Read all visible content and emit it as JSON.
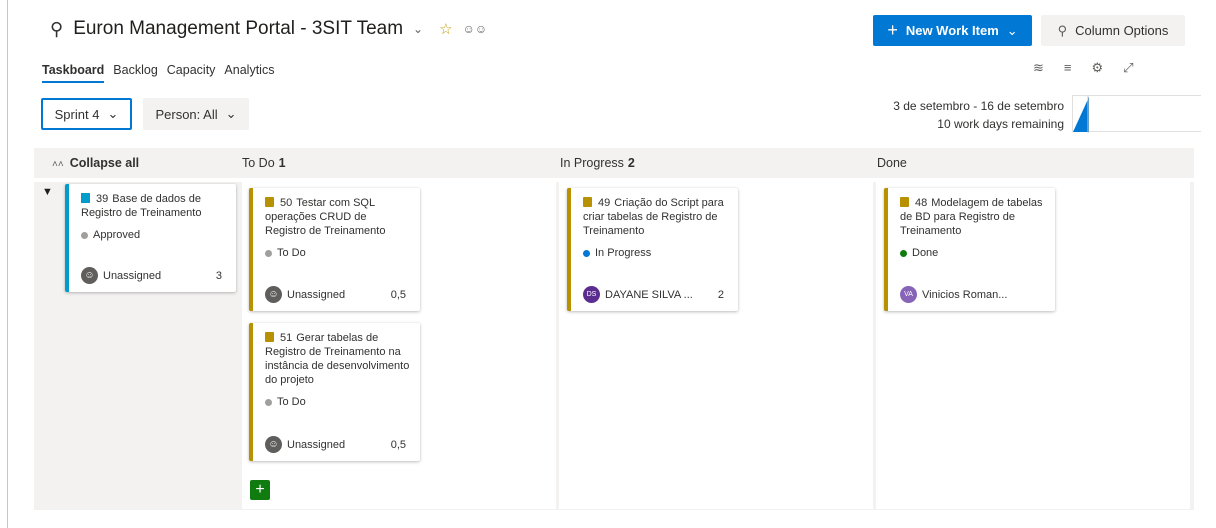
{
  "header": {
    "title": "Euron Management Portal - 3SIT Team",
    "team_icon": "team-icon",
    "favorite_icon": "star-icon",
    "members_icon": "people-icon"
  },
  "toolbar": {
    "new_work_item": "New Work Item",
    "column_options": "Column Options"
  },
  "tabs": [
    "Taskboard",
    "Backlog",
    "Capacity",
    "Analytics"
  ],
  "filters": {
    "sprint": "Sprint 4",
    "person": "Person: All"
  },
  "sprint_info": {
    "dates": "3 de setembro - 16 de setembro",
    "remaining": "10 work days remaining"
  },
  "columns": {
    "collapse_all": "Collapse all",
    "todo": {
      "label": "To Do",
      "count": "1"
    },
    "in_progress": {
      "label": "In Progress",
      "count": "2"
    },
    "done": {
      "label": "Done",
      "count": ""
    }
  },
  "backlog_item": {
    "id": "39",
    "title": "Base de dados de Registro de Treinamento",
    "state": "Approved",
    "assignee": "Unassigned",
    "effort": "3"
  },
  "tasks": {
    "t50": {
      "id": "50",
      "title": "Testar com SQL operações CRUD de Registro de Treinamento",
      "state": "To Do",
      "assignee": "Unassigned",
      "remaining": "0,5"
    },
    "t51": {
      "id": "51",
      "title": "Gerar tabelas de Registro de Treinamento na instância de desenvolvimento do projeto",
      "state": "To Do",
      "assignee": "Unassigned",
      "remaining": "0,5"
    },
    "t49": {
      "id": "49",
      "title": "Criação do Script para criar tabelas de Registro de Treinamento",
      "state": "In Progress",
      "assignee": "DAYANE SILVA ...",
      "initials": "DS",
      "remaining": "2"
    },
    "t48": {
      "id": "48",
      "title": "Modelagem de tabelas de BD para Registro de Treinamento",
      "state": "Done",
      "assignee": "Vinicios Roman...",
      "initials": "VA"
    }
  },
  "colors": {
    "accent": "#0078d4",
    "task": "#b79100",
    "pbi": "#009ccc",
    "state_todo": "#a19f9d",
    "state_inprogress": "#0078d4",
    "state_done": "#107c10",
    "state_approved": "#a19f9d"
  }
}
